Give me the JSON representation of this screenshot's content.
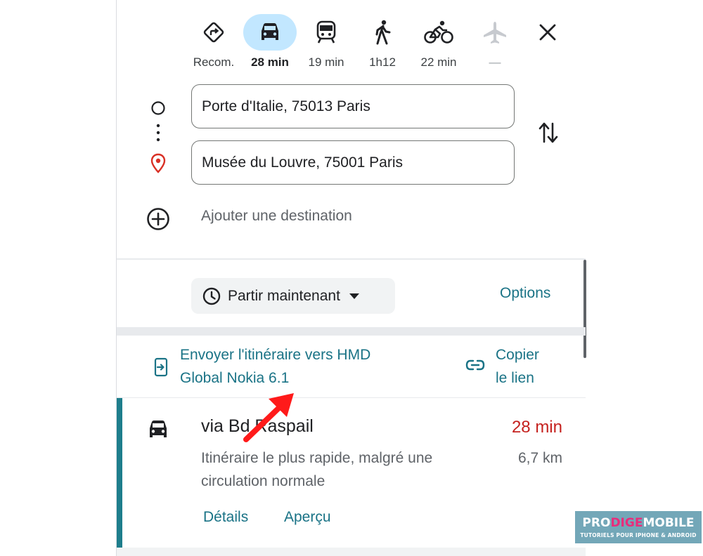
{
  "modes": [
    {
      "icon": "recommended-route-icon",
      "label": "Recom."
    },
    {
      "icon": "car-icon",
      "label": "28 min",
      "active": true
    },
    {
      "icon": "transit-icon",
      "label": "19 min"
    },
    {
      "icon": "walk-icon",
      "label": "1h12"
    },
    {
      "icon": "bike-icon",
      "label": "22 min"
    },
    {
      "icon": "flight-icon",
      "label": "—",
      "disabled": true
    }
  ],
  "origin": {
    "value": "Porte d'Italie, 75013 Paris"
  },
  "destination": {
    "value": "Musée du Louvre, 75001 Paris"
  },
  "add_destination": "Ajouter une destination",
  "depart": {
    "label": "Partir maintenant"
  },
  "options_label": "Options",
  "send": {
    "line1": "Envoyer l'itinéraire vers HMD",
    "line2": "Global Nokia 6.1"
  },
  "copy": {
    "line1": "Copier",
    "line2": "le lien"
  },
  "route": {
    "title": "via Bd Raspail",
    "duration": "28 min",
    "description_line1": "Itinéraire le plus rapide, malgré une",
    "description_line2": "circulation normale",
    "distance": "6,7 km",
    "details_label": "Détails",
    "preview_label": "Aperçu"
  },
  "watermark": {
    "part1": "PRO",
    "part2": "DIGE",
    "part3": "MOBILE",
    "subtitle": "TUTORIELS POUR IPHONE & ANDROID"
  },
  "colors": {
    "accent_teal": "#1a7386",
    "duration_red": "#c5221f",
    "active_pill": "#c2e7ff",
    "annotation_arrow": "#ff1a1a"
  }
}
